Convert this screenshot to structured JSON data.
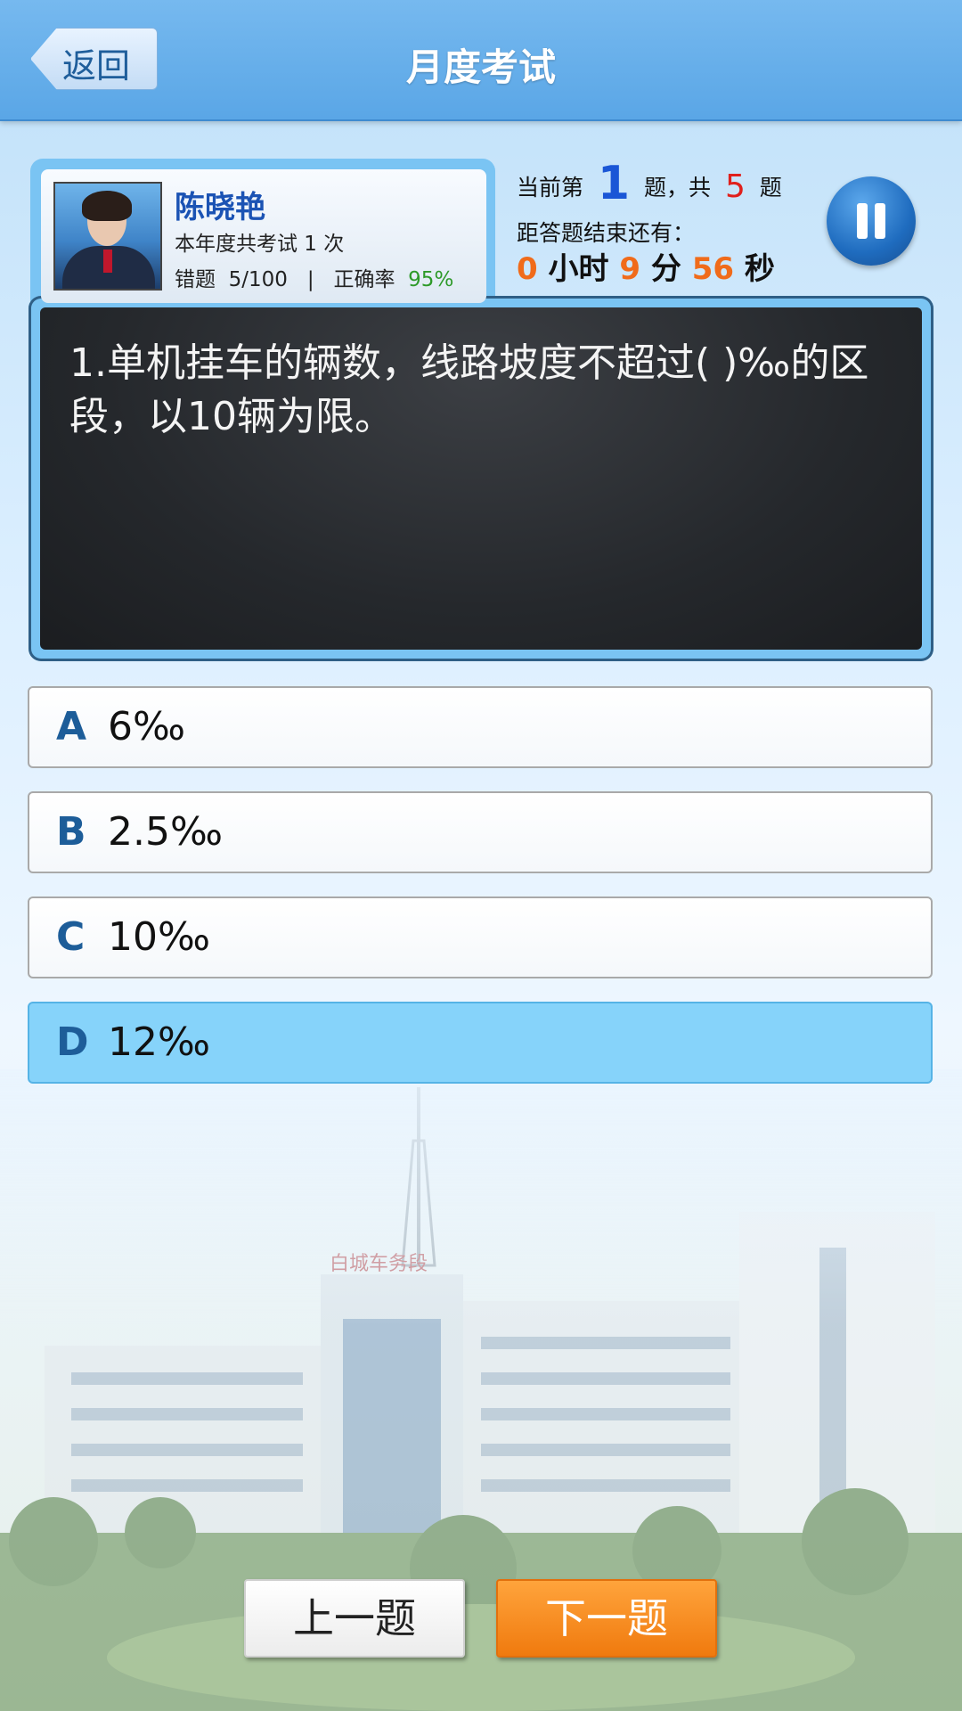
{
  "header": {
    "back_label": "返回",
    "title": "月度考试"
  },
  "profile": {
    "name": "陈晓艳",
    "exam_count_text": "本年度共考试   1  次",
    "wrong_label": "错题",
    "wrong_value": "5/100",
    "separator": "|",
    "accuracy_label": "正确率",
    "accuracy_value": "95%"
  },
  "progress": {
    "prefix": "当前第",
    "current": "1",
    "middle": "题，共",
    "total": "5",
    "suffix": "题",
    "remain_label": "距答题结束还有：",
    "hours": "0",
    "hours_unit": "小时",
    "minutes": "9",
    "minutes_unit": "分",
    "seconds": "56",
    "seconds_unit": "秒"
  },
  "question": {
    "text": "1.单机挂车的辆数，线路坡度不超过(    )‰的区段，以10辆为限。"
  },
  "options": [
    {
      "letter": "A",
      "text": "6‰",
      "selected": false
    },
    {
      "letter": "B",
      "text": "2.5‰",
      "selected": false
    },
    {
      "letter": "C",
      "text": "10‰",
      "selected": false
    },
    {
      "letter": "D",
      "text": "12‰",
      "selected": true
    }
  ],
  "background_sign": "白城车务段",
  "footer": {
    "prev_label": "上一题",
    "next_label": "下一题"
  },
  "colors": {
    "header": "#5aa6e6",
    "selected_option": "#86d3fa",
    "next_button": "#f07a0e",
    "timer_number": "#f06b1a",
    "accuracy": "#2e9a29"
  }
}
